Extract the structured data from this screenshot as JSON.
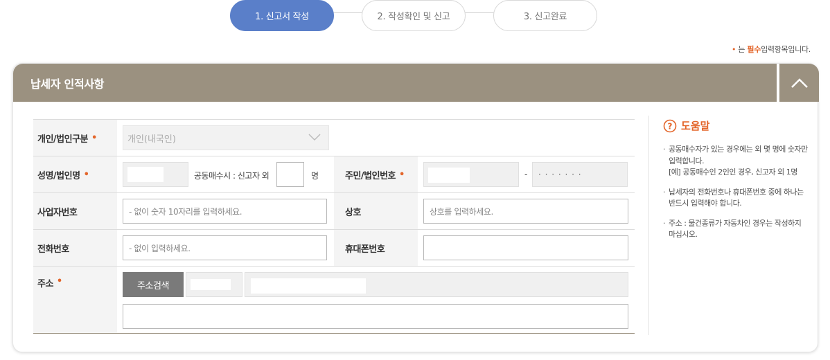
{
  "steps": [
    {
      "label": "1. 신고서 작성",
      "active": true
    },
    {
      "label": "2. 작성확인 및 신고",
      "active": false
    },
    {
      "label": "3. 신고완료",
      "active": false
    }
  ],
  "required_note": {
    "dot": "•",
    "prefix": "는",
    "emph": "필수",
    "suffix": "입력항목입니다."
  },
  "panel": {
    "title": "납세자 인적사항"
  },
  "form": {
    "type_label": "개인/법인구분",
    "type_value": "개인(내국인)",
    "name_label": "성명/법인명",
    "co_owner_text": "공동매수시 : 신고자 외",
    "co_owner_unit": "명",
    "co_owner_value": "",
    "id_label": "주민/법인번호",
    "id_dash": "-",
    "id_masked": "· · · · · · ·",
    "biz_label": "사업자번호",
    "biz_placeholder": "- 없이 숫자 10자리를 입력하세요.",
    "company_label": "상호",
    "company_placeholder": "상호를 입력하세요.",
    "phone_label": "전화번호",
    "phone_placeholder": "- 없이 입력하세요.",
    "mobile_label": "휴대폰번호",
    "mobile_value": "",
    "address_label": "주소",
    "address_button": "주소검색",
    "address_detail": "",
    "required_mark": "•"
  },
  "help": {
    "title": "도움말",
    "items": [
      {
        "text": "공동매수자가 있는 경우에는 외 몇 명에 숫자만 입력합니다.",
        "sub": "[예] 공동매수인 2인인 경우, 신고자 외 1명"
      },
      {
        "text": "납세자의 전화번호나 휴대폰번호 중에 하나는 반드시 입력해야 합니다.",
        "sub": ""
      },
      {
        "text": "주소 : 물건종류가 자동차인 경우는 작성하지 마십시오.",
        "sub": ""
      }
    ]
  },
  "colors": {
    "accent": "#5a7fc9",
    "header": "#9b9180",
    "required": "#e3652a"
  }
}
